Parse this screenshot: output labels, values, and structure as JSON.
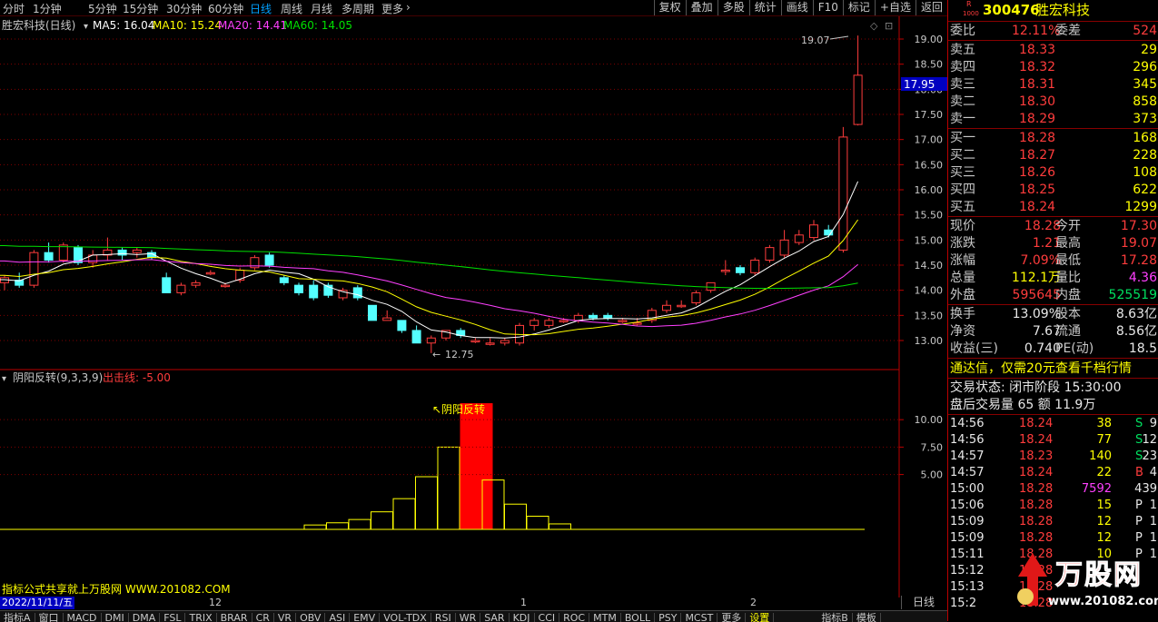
{
  "toolbar": {
    "periods": [
      "分时",
      "1分钟",
      "5分钟",
      "15分钟",
      "30分钟",
      "60分钟",
      "日线",
      "周线",
      "月线",
      "多周期",
      "更多"
    ],
    "active_period": "日线",
    "right_buttons": [
      "复权",
      "叠加",
      "多股",
      "统计",
      "画线",
      "F10",
      "标记",
      "+自选",
      "返回"
    ]
  },
  "chart": {
    "stock_label": "胜宏科技(日线)",
    "ma5": "MA5: 16.04",
    "ma10": "MA10: 15.24",
    "ma20": "MA20: 14.41",
    "ma60": "MA60: 14.05",
    "price_ticks": [
      "19.00",
      "18.50",
      "18.00",
      "17.50",
      "17.00",
      "16.50",
      "16.00",
      "15.50",
      "15.00",
      "14.50",
      "14.00",
      "13.50",
      "13.00"
    ],
    "current_price_tag": "17.95",
    "high_annotation": "19.07",
    "low_annotation": "12.75",
    "indicator_title": "阴阳反转(9,3,3,9)",
    "indicator_signal": "出击线: -5.00",
    "indicator_ticks": [
      "10.00",
      "7.50",
      "5.00"
    ],
    "indicator_annotation": "↖阴阳反转",
    "footer_note": "指标公式共享就上万股网 WWW.201082.COM",
    "date_label": "2022/11/11/五",
    "month_marks": [
      "12",
      "1",
      "2"
    ],
    "period_button": "日线"
  },
  "chart_data": [
    {
      "type": "candlestick",
      "title": "胜宏科技(日线)",
      "ylim": [
        12.6,
        19.3
      ],
      "candles": [
        {
          "o": 14.15,
          "h": 14.3,
          "l": 14.0,
          "c": 14.25
        },
        {
          "o": 14.2,
          "h": 14.35,
          "l": 14.05,
          "c": 14.1
        },
        {
          "o": 14.1,
          "h": 14.8,
          "l": 14.05,
          "c": 14.75
        },
        {
          "o": 14.75,
          "h": 14.95,
          "l": 14.55,
          "c": 14.6
        },
        {
          "o": 14.6,
          "h": 14.95,
          "l": 14.55,
          "c": 14.9
        },
        {
          "o": 14.85,
          "h": 14.9,
          "l": 14.5,
          "c": 14.55
        },
        {
          "o": 14.55,
          "h": 14.8,
          "l": 14.45,
          "c": 14.7
        },
        {
          "o": 14.7,
          "h": 15.05,
          "l": 14.6,
          "c": 14.8
        },
        {
          "o": 14.8,
          "h": 14.85,
          "l": 14.6,
          "c": 14.7
        },
        {
          "o": 14.75,
          "h": 14.85,
          "l": 14.65,
          "c": 14.8
        },
        {
          "o": 14.75,
          "h": 14.8,
          "l": 14.6,
          "c": 14.65
        },
        {
          "o": 14.25,
          "h": 14.35,
          "l": 13.95,
          "c": 13.95
        },
        {
          "o": 13.95,
          "h": 14.15,
          "l": 13.9,
          "c": 14.1
        },
        {
          "o": 14.1,
          "h": 14.2,
          "l": 14.05,
          "c": 14.15
        },
        {
          "o": 14.35,
          "h": 14.4,
          "l": 14.3,
          "c": 14.35
        },
        {
          "o": 14.1,
          "h": 14.15,
          "l": 14.05,
          "c": 14.1
        },
        {
          "o": 14.2,
          "h": 14.45,
          "l": 14.15,
          "c": 14.4
        },
        {
          "o": 14.45,
          "h": 14.7,
          "l": 14.4,
          "c": 14.65
        },
        {
          "o": 14.7,
          "h": 14.75,
          "l": 14.45,
          "c": 14.5
        },
        {
          "o": 14.25,
          "h": 14.3,
          "l": 14.1,
          "c": 14.15
        },
        {
          "o": 14.1,
          "h": 14.15,
          "l": 13.9,
          "c": 13.95
        },
        {
          "o": 14.1,
          "h": 14.2,
          "l": 13.8,
          "c": 13.85
        },
        {
          "o": 14.1,
          "h": 14.15,
          "l": 13.85,
          "c": 13.9
        },
        {
          "o": 13.85,
          "h": 14.05,
          "l": 13.8,
          "c": 14.0
        },
        {
          "o": 14.05,
          "h": 14.1,
          "l": 13.8,
          "c": 13.85
        },
        {
          "o": 13.7,
          "h": 13.7,
          "l": 13.4,
          "c": 13.4
        },
        {
          "o": 13.4,
          "h": 13.6,
          "l": 13.4,
          "c": 13.45
        },
        {
          "o": 13.4,
          "h": 13.4,
          "l": 13.15,
          "c": 13.2
        },
        {
          "o": 13.2,
          "h": 13.3,
          "l": 12.95,
          "c": 12.95
        },
        {
          "o": 12.95,
          "h": 13.1,
          "l": 12.75,
          "c": 13.05
        },
        {
          "o": 13.05,
          "h": 13.2,
          "l": 13.0,
          "c": 13.2
        },
        {
          "o": 13.2,
          "h": 13.25,
          "l": 13.05,
          "c": 13.1
        },
        {
          "o": 13.0,
          "h": 13.05,
          "l": 12.95,
          "c": 13.0
        },
        {
          "o": 12.95,
          "h": 13.05,
          "l": 12.9,
          "c": 12.95
        },
        {
          "o": 12.95,
          "h": 13.05,
          "l": 12.9,
          "c": 13.0
        },
        {
          "o": 12.95,
          "h": 13.35,
          "l": 12.9,
          "c": 13.3
        },
        {
          "o": 13.3,
          "h": 13.45,
          "l": 13.2,
          "c": 13.4
        },
        {
          "o": 13.3,
          "h": 13.45,
          "l": 13.25,
          "c": 13.4
        },
        {
          "o": 13.4,
          "h": 13.45,
          "l": 13.35,
          "c": 13.4
        },
        {
          "o": 13.4,
          "h": 13.55,
          "l": 13.35,
          "c": 13.5
        },
        {
          "o": 13.5,
          "h": 13.55,
          "l": 13.4,
          "c": 13.45
        },
        {
          "o": 13.5,
          "h": 13.55,
          "l": 13.4,
          "c": 13.45
        },
        {
          "o": 13.4,
          "h": 13.45,
          "l": 13.35,
          "c": 13.4
        },
        {
          "o": 13.35,
          "h": 13.45,
          "l": 13.3,
          "c": 13.35
        },
        {
          "o": 13.4,
          "h": 13.65,
          "l": 13.35,
          "c": 13.6
        },
        {
          "o": 13.6,
          "h": 13.8,
          "l": 13.55,
          "c": 13.7
        },
        {
          "o": 13.7,
          "h": 13.8,
          "l": 13.65,
          "c": 13.7
        },
        {
          "o": 13.75,
          "h": 14.0,
          "l": 13.7,
          "c": 13.95
        },
        {
          "o": 14.0,
          "h": 14.15,
          "l": 13.95,
          "c": 14.15
        },
        {
          "o": 14.4,
          "h": 14.6,
          "l": 14.3,
          "c": 14.4
        },
        {
          "o": 14.45,
          "h": 14.5,
          "l": 14.3,
          "c": 14.35
        },
        {
          "o": 14.35,
          "h": 14.65,
          "l": 14.3,
          "c": 14.6
        },
        {
          "o": 14.6,
          "h": 14.9,
          "l": 14.55,
          "c": 14.85
        },
        {
          "o": 14.7,
          "h": 15.2,
          "l": 14.65,
          "c": 15.0
        },
        {
          "o": 14.95,
          "h": 15.2,
          "l": 14.9,
          "c": 15.1
        },
        {
          "o": 15.05,
          "h": 15.4,
          "l": 15.0,
          "c": 15.3
        },
        {
          "o": 15.2,
          "h": 15.3,
          "l": 15.05,
          "c": 15.1
        },
        {
          "o": 14.8,
          "h": 17.25,
          "l": 14.75,
          "c": 17.05
        },
        {
          "o": 17.3,
          "h": 19.07,
          "l": 17.28,
          "c": 18.28
        }
      ],
      "ma_series": [
        {
          "name": "MA5",
          "value": 16.04,
          "color": "#ffffff"
        },
        {
          "name": "MA10",
          "value": 15.24,
          "color": "#ffff00"
        },
        {
          "name": "MA20",
          "value": 14.41,
          "color": "#ff40ff"
        },
        {
          "name": "MA60",
          "value": 14.05,
          "color": "#00e000"
        }
      ]
    },
    {
      "type": "bar",
      "title": "阴阳反转(9,3,3,9)",
      "ylim": [
        0,
        12
      ],
      "x": [
        29,
        30,
        31,
        32,
        33,
        34,
        35,
        36,
        37,
        38,
        39,
        40
      ],
      "values": [
        0.4,
        0.6,
        0.9,
        1.6,
        2.8,
        4.8,
        7.5,
        11.5,
        4.5,
        2.3,
        1.2,
        0.5
      ],
      "highlight_index": 7
    }
  ],
  "quote": {
    "market_tag": "R",
    "market_sub": "1000",
    "code": "300476",
    "name": "胜宏科技",
    "weibi_label": "委比",
    "weibi_value": "12.11%",
    "weicha_label": "委差",
    "weicha_value": "524",
    "asks": [
      {
        "label": "卖五",
        "price": "18.33",
        "vol": "29"
      },
      {
        "label": "卖四",
        "price": "18.32",
        "vol": "296"
      },
      {
        "label": "卖三",
        "price": "18.31",
        "vol": "345"
      },
      {
        "label": "卖二",
        "price": "18.30",
        "vol": "858"
      },
      {
        "label": "卖一",
        "price": "18.29",
        "vol": "373"
      }
    ],
    "bids": [
      {
        "label": "买一",
        "price": "18.28",
        "vol": "168"
      },
      {
        "label": "买二",
        "price": "18.27",
        "vol": "228"
      },
      {
        "label": "买三",
        "price": "18.26",
        "vol": "108"
      },
      {
        "label": "买四",
        "price": "18.25",
        "vol": "622"
      },
      {
        "label": "买五",
        "price": "18.24",
        "vol": "1299"
      }
    ],
    "stats": [
      {
        "l1": "现价",
        "v1": "18.28",
        "l2": "今开",
        "v2": "17.30",
        "c1": "red",
        "c2": "red"
      },
      {
        "l1": "涨跌",
        "v1": "1.21",
        "l2": "最高",
        "v2": "19.07",
        "c1": "red",
        "c2": "red"
      },
      {
        "l1": "涨幅",
        "v1": "7.09%",
        "l2": "最低",
        "v2": "17.28",
        "c1": "red",
        "c2": "red"
      },
      {
        "l1": "总量",
        "v1": "112.1万",
        "l2": "量比",
        "v2": "4.36",
        "c1": "yellow",
        "c2": "mag"
      },
      {
        "l1": "外盘",
        "v1": "595645",
        "l2": "内盘",
        "v2": "525519",
        "c1": "red",
        "c2": "green"
      }
    ],
    "stats2": [
      {
        "l1": "换手",
        "v1": "13.09%",
        "l2": "股本",
        "v2": "8.63亿"
      },
      {
        "l1": "净资",
        "v1": "7.67",
        "l2": "流通",
        "v2": "8.56亿"
      },
      {
        "l1": "收益(三)",
        "v1": "0.740",
        "l2": "PE(动)",
        "v2": "18.5"
      }
    ],
    "ad_text": "通达信，仅需20元查看千档行情",
    "trade_status": "交易状态: 闭市阶段 15:30:00",
    "after_hours": "盘后交易量 65 额 11.9万",
    "ticks": [
      {
        "t": "14:56",
        "p": "18.24",
        "v": "38",
        "d": "S",
        "n": "9"
      },
      {
        "t": "14:56",
        "p": "18.24",
        "v": "77",
        "d": "S",
        "n": "12"
      },
      {
        "t": "14:57",
        "p": "18.23",
        "v": "140",
        "d": "S",
        "n": "23"
      },
      {
        "t": "14:57",
        "p": "18.24",
        "v": "22",
        "d": "B",
        "n": "4"
      },
      {
        "t": "15:00",
        "p": "18.28",
        "v": "7592",
        "d": "",
        "n": "439"
      },
      {
        "t": "15:06",
        "p": "18.28",
        "v": "15",
        "d": "P",
        "n": "1"
      },
      {
        "t": "15:09",
        "p": "18.28",
        "v": "12",
        "d": "P",
        "n": "1"
      },
      {
        "t": "15:09",
        "p": "18.28",
        "v": "12",
        "d": "P",
        "n": "1"
      },
      {
        "t": "15:11",
        "p": "18.28",
        "v": "10",
        "d": "P",
        "n": "1"
      },
      {
        "t": "15:12",
        "p": "18.28",
        "v": "",
        "d": "",
        "n": ""
      },
      {
        "t": "15:13",
        "p": "18.28",
        "v": "",
        "d": "",
        "n": ""
      },
      {
        "t": "15:2",
        "p": "18.28",
        "v": "",
        "d": "",
        "n": ""
      }
    ],
    "watermark_text": "万股网",
    "watermark_url": "www.201082.com"
  },
  "bottom_tabs": [
    "指标A",
    "窗口",
    "MACD",
    "DMI",
    "DMA",
    "FSL",
    "TRIX",
    "BRAR",
    "CR",
    "VR",
    "OBV",
    "ASI",
    "EMV",
    "VOL-TDX",
    "RSI",
    "WR",
    "SAR",
    "KDJ",
    "CCI",
    "ROC",
    "MTM",
    "BOLL",
    "PSY",
    "MCST",
    "更多",
    "设置"
  ],
  "bottom_right_tabs": [
    "指标B",
    "模板"
  ],
  "colors": {
    "up": "#ff3c3c",
    "down": "#54ffff",
    "ma5": "#ffffff",
    "ma10": "#ffff00",
    "ma20": "#ff40ff",
    "ma60": "#00e000",
    "grid": "#800000"
  }
}
